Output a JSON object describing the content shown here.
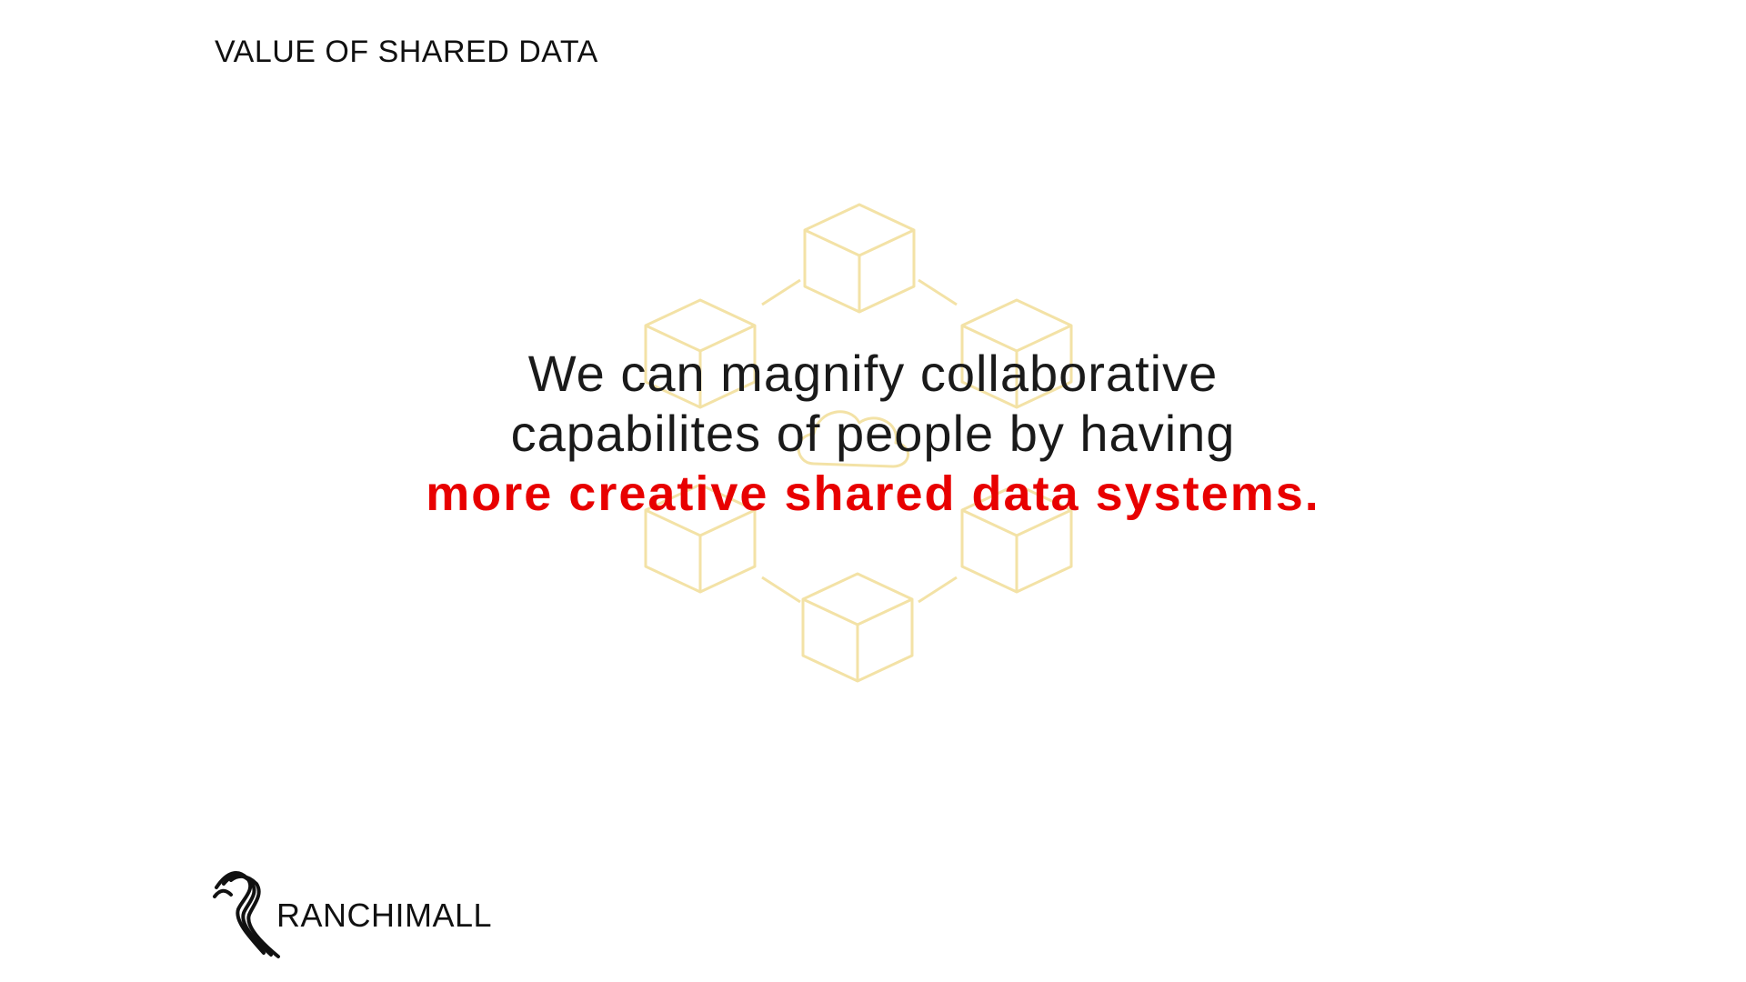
{
  "slide": {
    "title": "VALUE OF SHARED DATA",
    "quote_line_1": "We can magnify collaborative",
    "quote_line_2": "capabilites of people by having",
    "quote_highlight": "more creative shared data systems."
  },
  "brand": {
    "logo_icon": "ranchimall-logo-icon",
    "name": "RANCHIMALL"
  },
  "colors": {
    "background": "#ffffff",
    "text": "#1a1a1a",
    "highlight": "#e80000",
    "graphic": "#f3e2a6"
  }
}
